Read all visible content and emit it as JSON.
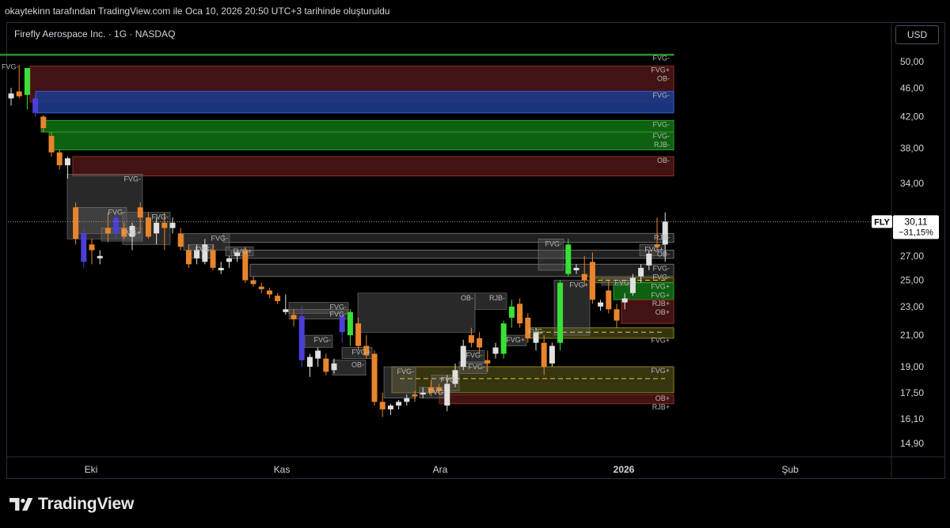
{
  "header": {
    "caption": "okaytekinn tarafından TradingView.com ile Oca 10, 2026 20:50 UTC+3 tarihinde oluşturuldu"
  },
  "chart": {
    "symbol_title": "Firefly Aerospace Inc. · 1G · NASDAQ",
    "currency": "USD"
  },
  "brand": {
    "name": "TradingView",
    "icon": "tradingview-logo-icon"
  },
  "colors": {
    "background": "#000000",
    "up_candle": "#e0e0e0",
    "down_candle": "#e8842c",
    "green_candle": "#38e038",
    "blue_candle": "#4a3fd6",
    "fvg_green_zone": "#0e6b12",
    "ob_red_zone": "#4a1414",
    "blue_zone": "#1c3a8a",
    "gray_zone": "#3a3a3a",
    "olive_zone": "#3d3a12",
    "price_tag": "#ffffff"
  },
  "chart_data": {
    "type": "candlestick",
    "symbol": "FLY",
    "last_price": "30,11",
    "change_percent": "−31,15%",
    "y_ticks": [
      "50,00",
      "46,00",
      "42,00",
      "38,00",
      "34,00",
      "27,00",
      "25,00",
      "23,00",
      "21,00",
      "19,00",
      "17,50",
      "16,10",
      "14,90"
    ],
    "x_ticks": [
      "Eki",
      "Kas",
      "Ara",
      "2026",
      "Şub"
    ],
    "scale": "log",
    "candles": [
      {
        "o": 44.5,
        "h": 46.0,
        "l": 43.5,
        "c": 45.2,
        "k": "u"
      },
      {
        "o": 45.5,
        "h": 49.5,
        "l": 44.5,
        "c": 44.8,
        "k": "d"
      },
      {
        "o": 45.0,
        "h": 49.0,
        "l": 43.0,
        "c": 49.0,
        "k": "g"
      },
      {
        "o": 44.5,
        "h": 45.0,
        "l": 42.0,
        "c": 42.5,
        "k": "b"
      },
      {
        "o": 42.0,
        "h": 42.2,
        "l": 40.0,
        "c": 40.5,
        "k": "d"
      },
      {
        "o": 39.5,
        "h": 40.0,
        "l": 37.0,
        "c": 37.5,
        "k": "d"
      },
      {
        "o": 37.5,
        "h": 37.8,
        "l": 35.5,
        "c": 36.0,
        "k": "d"
      },
      {
        "o": 36.0,
        "h": 37.0,
        "l": 34.5,
        "c": 36.8,
        "k": "u"
      },
      {
        "o": 31.5,
        "h": 32.0,
        "l": 28.0,
        "c": 28.5,
        "k": "d"
      },
      {
        "o": 29.0,
        "h": 29.5,
        "l": 26.0,
        "c": 26.5,
        "k": "b"
      },
      {
        "o": 28.0,
        "h": 28.5,
        "l": 26.3,
        "c": 27.5,
        "k": "d"
      },
      {
        "o": 26.8,
        "h": 27.5,
        "l": 26.3,
        "c": 27.0,
        "k": "u"
      },
      {
        "o": 29.0,
        "h": 31.0,
        "l": 28.2,
        "c": 29.5,
        "k": "d"
      },
      {
        "o": 29.0,
        "h": 31.0,
        "l": 28.5,
        "c": 30.5,
        "k": "b"
      },
      {
        "o": 29.5,
        "h": 30.0,
        "l": 28.5,
        "c": 28.7,
        "k": "d"
      },
      {
        "o": 28.7,
        "h": 30.0,
        "l": 27.5,
        "c": 29.7,
        "k": "u"
      },
      {
        "o": 30.5,
        "h": 32.0,
        "l": 29.0,
        "c": 31.5,
        "k": "d"
      },
      {
        "o": 28.7,
        "h": 31.0,
        "l": 28.5,
        "c": 30.5,
        "k": "d"
      },
      {
        "o": 29.0,
        "h": 30.5,
        "l": 28.0,
        "c": 30.0,
        "k": "u"
      },
      {
        "o": 30.0,
        "h": 31.0,
        "l": 27.5,
        "c": 29.5,
        "k": "d"
      },
      {
        "o": 29.5,
        "h": 30.5,
        "l": 29.0,
        "c": 30.0,
        "k": "u"
      },
      {
        "o": 29.0,
        "h": 29.5,
        "l": 27.5,
        "c": 27.8,
        "k": "d"
      },
      {
        "o": 27.5,
        "h": 28.0,
        "l": 26.0,
        "c": 26.3,
        "k": "d"
      },
      {
        "o": 27.5,
        "h": 28.0,
        "l": 26.3,
        "c": 26.8,
        "k": "u"
      },
      {
        "o": 26.5,
        "h": 28.5,
        "l": 26.3,
        "c": 28.0,
        "k": "u"
      },
      {
        "o": 27.5,
        "h": 28.0,
        "l": 25.8,
        "c": 26.0,
        "k": "d"
      },
      {
        "o": 26.0,
        "h": 26.5,
        "l": 25.5,
        "c": 25.8,
        "k": "u"
      },
      {
        "o": 26.5,
        "h": 27.0,
        "l": 26.0,
        "c": 26.8,
        "k": "u"
      },
      {
        "o": 27.0,
        "h": 27.5,
        "l": 26.5,
        "c": 27.3,
        "k": "u"
      },
      {
        "o": 27.5,
        "h": 27.8,
        "l": 24.8,
        "c": 25.0,
        "k": "d"
      },
      {
        "o": 25.0,
        "h": 25.3,
        "l": 24.5,
        "c": 24.7,
        "k": "d"
      },
      {
        "o": 24.5,
        "h": 24.8,
        "l": 24.0,
        "c": 24.3,
        "k": "d"
      },
      {
        "o": 24.2,
        "h": 24.4,
        "l": 23.6,
        "c": 23.9,
        "k": "d"
      },
      {
        "o": 23.8,
        "h": 24.0,
        "l": 23.2,
        "c": 23.4,
        "k": "d"
      },
      {
        "o": 22.6,
        "h": 23.9,
        "l": 22.4,
        "c": 22.8,
        "k": "u"
      },
      {
        "o": 22.4,
        "h": 22.8,
        "l": 21.6,
        "c": 22.1,
        "k": "d"
      },
      {
        "o": 22.3,
        "h": 23.0,
        "l": 19.0,
        "c": 19.4,
        "k": "b"
      },
      {
        "o": 19.0,
        "h": 19.8,
        "l": 18.4,
        "c": 19.6,
        "k": "u"
      },
      {
        "o": 19.5,
        "h": 20.2,
        "l": 19.0,
        "c": 20.0,
        "k": "u"
      },
      {
        "o": 19.5,
        "h": 19.8,
        "l": 18.5,
        "c": 18.7,
        "k": "d"
      },
      {
        "o": 18.8,
        "h": 19.5,
        "l": 18.6,
        "c": 19.2,
        "k": "u"
      },
      {
        "o": 21.2,
        "h": 22.5,
        "l": 20.5,
        "c": 22.3,
        "k": "b"
      },
      {
        "o": 21.0,
        "h": 22.8,
        "l": 20.3,
        "c": 22.6,
        "k": "g"
      },
      {
        "o": 21.8,
        "h": 22.2,
        "l": 20.0,
        "c": 20.3,
        "k": "d"
      },
      {
        "o": 20.3,
        "h": 21.0,
        "l": 19.5,
        "c": 19.7,
        "k": "d"
      },
      {
        "o": 19.8,
        "h": 20.0,
        "l": 16.8,
        "c": 17.0,
        "k": "d"
      },
      {
        "o": 17.0,
        "h": 17.5,
        "l": 16.2,
        "c": 16.6,
        "k": "d"
      },
      {
        "o": 16.6,
        "h": 16.9,
        "l": 16.3,
        "c": 16.8,
        "k": "u"
      },
      {
        "o": 16.8,
        "h": 17.1,
        "l": 16.6,
        "c": 17.0,
        "k": "u"
      },
      {
        "o": 17.0,
        "h": 17.4,
        "l": 16.8,
        "c": 17.2,
        "k": "u"
      },
      {
        "o": 17.3,
        "h": 17.6,
        "l": 17.0,
        "c": 17.4,
        "k": "d"
      },
      {
        "o": 17.4,
        "h": 17.8,
        "l": 17.2,
        "c": 17.5,
        "k": "u"
      },
      {
        "o": 17.5,
        "h": 18.2,
        "l": 17.3,
        "c": 17.8,
        "k": "d"
      },
      {
        "o": 17.8,
        "h": 18.0,
        "l": 17.4,
        "c": 17.6,
        "k": "d"
      },
      {
        "o": 16.8,
        "h": 18.5,
        "l": 16.5,
        "c": 18.0,
        "k": "u"
      },
      {
        "o": 18.0,
        "h": 19.2,
        "l": 17.8,
        "c": 18.8,
        "k": "u"
      },
      {
        "o": 19.0,
        "h": 20.7,
        "l": 18.8,
        "c": 20.3,
        "k": "u"
      },
      {
        "o": 20.5,
        "h": 21.5,
        "l": 20.2,
        "c": 21.0,
        "k": "d"
      },
      {
        "o": 20.8,
        "h": 21.2,
        "l": 19.8,
        "c": 20.2,
        "k": "d"
      },
      {
        "o": 19.2,
        "h": 20.0,
        "l": 18.7,
        "c": 19.4,
        "k": "d"
      },
      {
        "o": 19.8,
        "h": 20.5,
        "l": 19.5,
        "c": 20.2,
        "k": "u"
      },
      {
        "o": 19.8,
        "h": 22.0,
        "l": 19.5,
        "c": 21.8,
        "k": "g"
      },
      {
        "o": 22.2,
        "h": 23.5,
        "l": 21.5,
        "c": 23.0,
        "k": "g"
      },
      {
        "o": 23.2,
        "h": 23.6,
        "l": 21.5,
        "c": 21.8,
        "k": "d"
      },
      {
        "o": 22.2,
        "h": 22.5,
        "l": 20.5,
        "c": 20.8,
        "k": "d"
      },
      {
        "o": 20.5,
        "h": 21.5,
        "l": 20.0,
        "c": 21.2,
        "k": "u"
      },
      {
        "o": 20.5,
        "h": 21.0,
        "l": 18.5,
        "c": 19.0,
        "k": "d"
      },
      {
        "o": 19.2,
        "h": 20.5,
        "l": 19.0,
        "c": 20.3,
        "k": "u"
      },
      {
        "o": 20.5,
        "h": 25.0,
        "l": 20.0,
        "c": 24.8,
        "k": "g"
      },
      {
        "o": 25.5,
        "h": 28.5,
        "l": 25.3,
        "c": 28.0,
        "k": "g"
      },
      {
        "o": 26.0,
        "h": 26.3,
        "l": 25.5,
        "c": 25.8,
        "k": "u"
      },
      {
        "o": 25.5,
        "h": 27.0,
        "l": 24.5,
        "c": 25.0,
        "k": "d"
      },
      {
        "o": 26.5,
        "h": 27.3,
        "l": 23.2,
        "c": 23.5,
        "k": "d"
      },
      {
        "o": 23.0,
        "h": 23.5,
        "l": 22.7,
        "c": 23.3,
        "k": "u"
      },
      {
        "o": 24.2,
        "h": 25.0,
        "l": 22.5,
        "c": 22.8,
        "k": "d"
      },
      {
        "o": 22.8,
        "h": 23.2,
        "l": 21.5,
        "c": 22.0,
        "k": "d"
      },
      {
        "o": 23.3,
        "h": 24.0,
        "l": 22.8,
        "c": 23.6,
        "k": "u"
      },
      {
        "o": 24.0,
        "h": 25.5,
        "l": 23.8,
        "c": 25.2,
        "k": "u"
      },
      {
        "o": 25.3,
        "h": 26.3,
        "l": 24.8,
        "c": 26.0,
        "k": "u"
      },
      {
        "o": 26.2,
        "h": 27.5,
        "l": 25.8,
        "c": 27.2,
        "k": "u"
      },
      {
        "o": 28.0,
        "h": 30.5,
        "l": 27.5,
        "c": 27.8,
        "k": "d"
      },
      {
        "o": 28.0,
        "h": 31.0,
        "l": 26.5,
        "c": 30.11,
        "k": "u"
      }
    ],
    "zones": [
      {
        "x0": 0,
        "x1": 85,
        "top": 51.2,
        "bottom": 51.0,
        "k": "green-line",
        "labels": [
          {
            "at": "right",
            "text": "FVG-"
          },
          {
            "at": "left",
            "text": "FVG-"
          }
        ]
      },
      {
        "x0": 38,
        "x1": 85,
        "top": 49.3,
        "bottom": 44.0,
        "k": "red",
        "labels": [
          {
            "at": "right",
            "text": "FVG+"
          },
          {
            "at": "right",
            "text": "OB-"
          }
        ]
      },
      {
        "x0": 45,
        "x1": 85,
        "top": 45.5,
        "bottom": 42.5,
        "k": "blue",
        "labels": [
          {
            "at": "right",
            "text": "FVG-"
          }
        ]
      },
      {
        "x0": 52,
        "x1": 85,
        "top": 41.5,
        "bottom": 40.0,
        "k": "green",
        "labels": [
          {
            "at": "right",
            "text": "FVG-"
          }
        ]
      },
      {
        "x0": 62,
        "x1": 85,
        "top": 40.0,
        "bottom": 37.8,
        "k": "green",
        "labels": [
          {
            "at": "right",
            "text": "FVG-"
          },
          {
            "at": "right",
            "text": "RJB-"
          }
        ]
      },
      {
        "x0": 92,
        "x1": 85,
        "top": 37.0,
        "bottom": 34.8,
        "k": "red",
        "labels": [
          {
            "at": "right",
            "text": "OB-"
          }
        ]
      },
      {
        "x0": 282,
        "x1": 72,
        "top": 29.0,
        "bottom": 28.2,
        "k": "gray",
        "labels": [
          {
            "at": "right",
            "text": "RJB-"
          }
        ]
      },
      {
        "x0": 292,
        "x1": 72,
        "top": 27.5,
        "bottom": 26.8,
        "k": "gray",
        "labels": [
          {
            "at": "right",
            "text": "OB-"
          }
        ]
      },
      {
        "x0": 316,
        "x1": 72,
        "top": 26.3,
        "bottom": 25.3,
        "k": "gray",
        "labels": [
          {
            "at": "right",
            "text": "FVG-"
          },
          {
            "at": "right",
            "text": "FVG-"
          }
        ]
      },
      {
        "x0": 555,
        "x1": 85,
        "top": 17.4,
        "bottom": 16.9,
        "k": "red",
        "labels": [
          {
            "at": "right",
            "text": "OB+"
          },
          {
            "at": "right",
            "text": "RJB+"
          }
        ]
      },
      {
        "x0": 495,
        "x1": 84,
        "top": 19.0,
        "bottom": 17.5,
        "k": "olive",
        "labels": [
          {
            "at": "right",
            "text": "FVG+"
          }
        ]
      },
      {
        "x0": 745,
        "x1": 84,
        "top": 25.2,
        "bottom": 24.8,
        "k": "olive",
        "labels": []
      },
      {
        "x0": 775,
        "x1": 85,
        "top": 24.8,
        "bottom": 23.5,
        "k": "green",
        "labels": [
          {
            "at": "right",
            "text": "FVG+"
          },
          {
            "at": "right",
            "text": "FVG+"
          }
        ]
      },
      {
        "x0": 785,
        "x1": 85,
        "top": 23.5,
        "bottom": 21.8,
        "k": "red",
        "labels": [
          {
            "at": "right",
            "text": "RJB+"
          },
          {
            "at": "right",
            "text": "OB+"
          }
        ]
      },
      {
        "x0": 665,
        "x1": 84,
        "top": 21.5,
        "bottom": 20.8,
        "k": "olive",
        "labels": [
          {
            "at": "left",
            "text": "FVG-"
          },
          {
            "at": "right",
            "text": "FVG+"
          }
        ]
      }
    ],
    "gray_boxes": [
      {
        "x0": 85,
        "x1": 180,
        "top": 35.0,
        "bottom": 28.5,
        "label": "FVG-"
      },
      {
        "x0": 95,
        "x1": 160,
        "top": 31.5,
        "bottom": 29.0,
        "label": "FVG-"
      },
      {
        "x0": 128,
        "x1": 180,
        "top": 29.5,
        "bottom": 28.3,
        "label": "FVG+"
      },
      {
        "x0": 155,
        "x1": 215,
        "top": 31.0,
        "bottom": 28.0,
        "label": "FVG-"
      },
      {
        "x0": 232,
        "x1": 290,
        "top": 29.0,
        "bottom": 27.5,
        "label": "FVG-"
      },
      {
        "x0": 238,
        "x1": 270,
        "top": 28.0,
        "bottom": 26.8,
        "label": "FVG-"
      },
      {
        "x0": 285,
        "x1": 320,
        "top": 27.8,
        "bottom": 27.0,
        "label": "FVG+"
      },
      {
        "x0": 365,
        "x1": 440,
        "top": 23.3,
        "bottom": 22.5,
        "label": "FVG-"
      },
      {
        "x0": 365,
        "x1": 440,
        "top": 22.8,
        "bottom": 22.1,
        "label": "FVG-"
      },
      {
        "x0": 452,
        "x1": 600,
        "top": 24.0,
        "bottom": 21.2,
        "label": "OB-"
      },
      {
        "x0": 600,
        "x1": 640,
        "top": 24.0,
        "bottom": 22.8,
        "label": "RJB-"
      },
      {
        "x0": 385,
        "x1": 420,
        "top": 21.0,
        "bottom": 20.2,
        "label": "FVG-"
      },
      {
        "x0": 432,
        "x1": 470,
        "top": 20.2,
        "bottom": 19.5,
        "label": "FVG+"
      },
      {
        "x0": 420,
        "x1": 462,
        "top": 19.4,
        "bottom": 18.5,
        "label": "OB-"
      },
      {
        "x0": 485,
        "x1": 525,
        "top": 19.0,
        "bottom": 17.2,
        "label": "FVG-"
      },
      {
        "x0": 530,
        "x1": 565,
        "top": 17.8,
        "bottom": 17.2,
        "label": "FVG-"
      },
      {
        "x0": 545,
        "x1": 580,
        "top": 18.5,
        "bottom": 17.6,
        "label": "FVG-"
      },
      {
        "x0": 580,
        "x1": 615,
        "top": 19.3,
        "bottom": 18.6,
        "label": "FVG-"
      },
      {
        "x0": 585,
        "x1": 612,
        "top": 20.0,
        "bottom": 19.2,
        "label": "FVG-"
      },
      {
        "x0": 633,
        "x1": 665,
        "top": 21.0,
        "bottom": 20.3,
        "label": "FVG+"
      },
      {
        "x0": 700,
        "x1": 745,
        "top": 25.0,
        "bottom": 21.0,
        "label": "FVG+"
      },
      {
        "x0": 680,
        "x1": 712,
        "top": 28.5,
        "bottom": 25.8,
        "label": "FVG-"
      },
      {
        "x0": 760,
        "x1": 800,
        "top": 25.2,
        "bottom": 24.6,
        "label": "FVG-"
      },
      {
        "x0": 808,
        "x1": 840,
        "top": 28.0,
        "bottom": 27.0,
        "label": "FVG+"
      }
    ],
    "dashed_levels": [
      {
        "x0": 745,
        "x1": 840,
        "price": 25.0
      },
      {
        "x0": 680,
        "x1": 840,
        "price": 21.2
      },
      {
        "x0": 505,
        "x1": 840,
        "price": 18.3
      }
    ]
  }
}
